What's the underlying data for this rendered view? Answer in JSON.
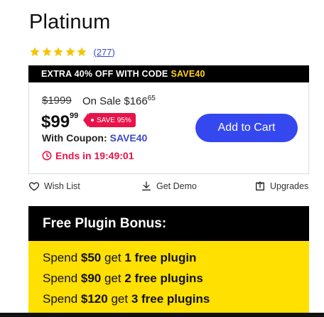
{
  "product": {
    "title": "Platinum"
  },
  "rating": {
    "stars": 5,
    "count_label": "(277)",
    "star_color": "#f5c400"
  },
  "promo": {
    "prefix": "EXTRA 40% OFF WITH CODE",
    "code": "SAVE40"
  },
  "pricing": {
    "old_price": "$1999",
    "sale_label": "On Sale $166",
    "sale_cents": "65",
    "price_dollars": "$99",
    "price_cents": "99",
    "save_badge": "SAVE 95%",
    "coupon_label": "With Coupon:",
    "coupon_code": "SAVE40",
    "ends_label": "Ends in 19:49:01"
  },
  "cart": {
    "label": "Add to Cart",
    "color": "#3548f0"
  },
  "actions": {
    "wishlist": "Wish List",
    "demo": "Get Demo",
    "upgrades": "Upgrades"
  },
  "bonus": {
    "title": "Free Plugin Bonus:",
    "lines": [
      {
        "pre": "Spend ",
        "amount": "$50",
        "mid": " get ",
        "reward": "1 free plugin"
      },
      {
        "pre": "Spend ",
        "amount": "$90",
        "mid": " get ",
        "reward": "2 free plugins"
      },
      {
        "pre": "Spend ",
        "amount": "$120",
        "mid": " get ",
        "reward": "3 free plugins"
      }
    ],
    "background": "#ffe000"
  }
}
